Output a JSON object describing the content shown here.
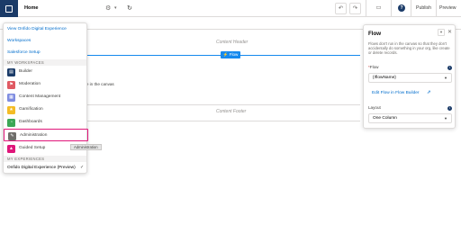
{
  "topbar": {
    "page_name": "Home",
    "gear_icon": "gear-icon",
    "undo_icon": "undo-icon",
    "redo_icon": "redo-icon",
    "preview_device_icon": "desktop-icon",
    "help_icon": "question-icon",
    "help_glyph": "?",
    "publish_label": "Publish",
    "preview_label": "Preview"
  },
  "canvas": {
    "content_header": "Content Header",
    "flow_tag": "Flow",
    "canvas_hint": "...e in the canvas",
    "content_footer": "Content Footer"
  },
  "menu": {
    "links": [
      "View Onfido Digital Experience",
      "Workspaces",
      "Salesforce Setup"
    ],
    "workspaces_header": "MY WORKSPACES",
    "items": [
      {
        "label": "Builder",
        "icon": "builder-icon",
        "color": "#1b3b68"
      },
      {
        "label": "Moderation",
        "icon": "moderation-icon",
        "color": "#e05a63"
      },
      {
        "label": "Content Management",
        "icon": "content-icon",
        "color": "#7f8de1"
      },
      {
        "label": "Gamification",
        "icon": "gamification-icon",
        "color": "#f4bc25"
      },
      {
        "label": "Dashboards",
        "icon": "dashboards-icon",
        "color": "#3ba755"
      },
      {
        "label": "Administration",
        "icon": "administration-icon",
        "color": "#706e6b"
      },
      {
        "label": "Guided Setup",
        "icon": "guided-setup-icon",
        "color": "#e0167a"
      }
    ],
    "experiences_header": "MY EXPERIENCES",
    "experience_item": "Onfido Digital Experience (Preview)",
    "tooltip": "Administration"
  },
  "panel": {
    "title": "Flow",
    "description": "Flows don't run in the canvas so that they don't accidentally do something in your org, like create or delete records.",
    "flow_label": "Flow",
    "flow_value": "{!flowName}",
    "edit_link": "Edit Flow in Flow Builder",
    "layout_label": "Layout",
    "layout_value": "One Column",
    "accent": "#1589ee"
  }
}
